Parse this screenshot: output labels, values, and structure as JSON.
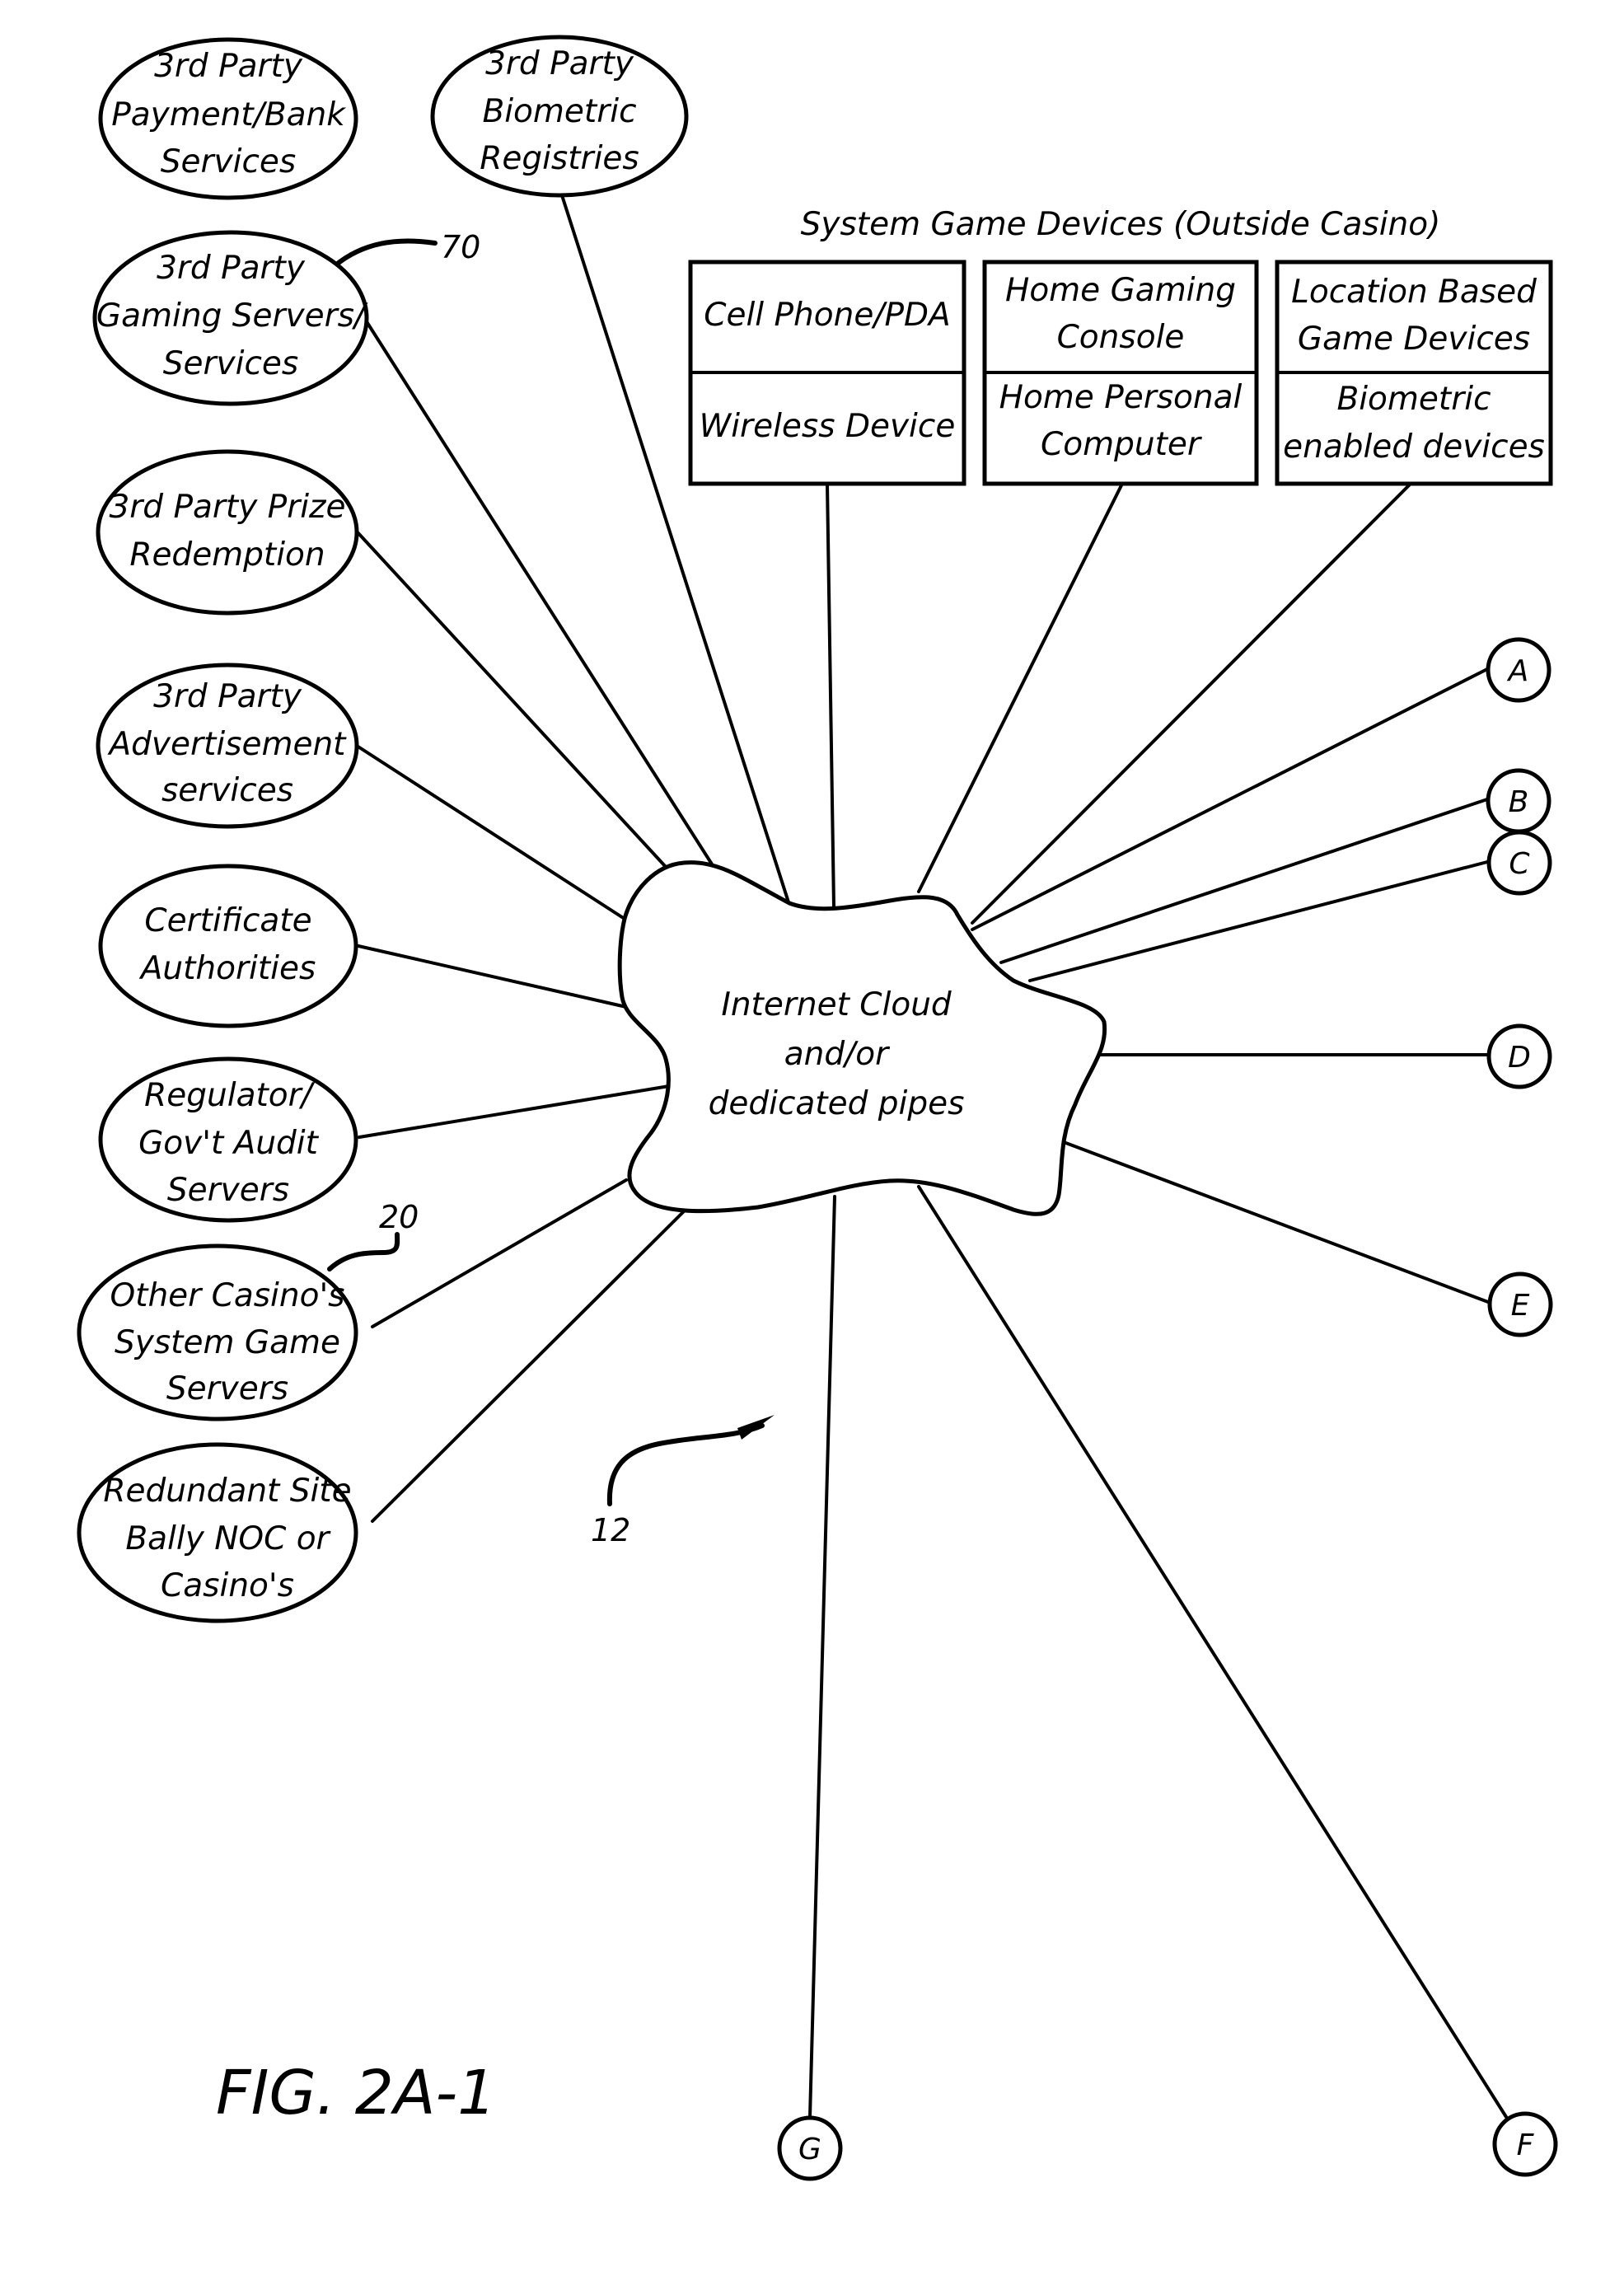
{
  "figure_label": "FIG. 2A-1",
  "cloud": {
    "lines": [
      "Internet Cloud",
      "and/or",
      "dedicated pipes"
    ],
    "reference": "12"
  },
  "outside_casino_group": {
    "caption": "System Game Devices (Outside Casino)",
    "boxes": [
      {
        "top": [
          "Cell Phone/PDA"
        ],
        "bottom": [
          "Wireless Device"
        ]
      },
      {
        "top": [
          "Home Gaming",
          "Console"
        ],
        "bottom": [
          "Home Personal",
          "Computer"
        ]
      },
      {
        "top": [
          "Location Based",
          "Game Devices"
        ],
        "bottom": [
          "Biometric",
          "enabled devices"
        ]
      }
    ]
  },
  "services": [
    {
      "id": "payment-bank",
      "lines": [
        "3rd Party",
        "Payment/Bank",
        "Services"
      ],
      "connected": false
    },
    {
      "id": "biometric-registries",
      "lines": [
        "3rd Party",
        "Biometric",
        "Registries"
      ],
      "connected": true
    },
    {
      "id": "gaming-servers",
      "lines": [
        "3rd Party",
        "Gaming Servers/",
        "Services"
      ],
      "connected": true,
      "reference": "70"
    },
    {
      "id": "prize-redemption",
      "lines": [
        "3rd Party Prize",
        "Redemption"
      ],
      "connected": true
    },
    {
      "id": "advertisement",
      "lines": [
        "3rd Party",
        "Advertisement",
        "services"
      ],
      "connected": true
    },
    {
      "id": "certificate-authorities",
      "lines": [
        "Certificate",
        "Authorities"
      ],
      "connected": true
    },
    {
      "id": "regulator-audit",
      "lines": [
        "Regulator/",
        "Gov't Audit",
        "Servers"
      ],
      "connected": true
    },
    {
      "id": "other-casino",
      "lines": [
        "Other Casino's",
        "System Game",
        "Servers"
      ],
      "connected": true,
      "reference": "20"
    },
    {
      "id": "redundant-site",
      "lines": [
        "Redundant Site",
        "Bally NOC or",
        "Casino's"
      ],
      "connected": true
    }
  ],
  "off_page_connectors": [
    "A",
    "B",
    "C",
    "D",
    "E",
    "F",
    "G"
  ]
}
